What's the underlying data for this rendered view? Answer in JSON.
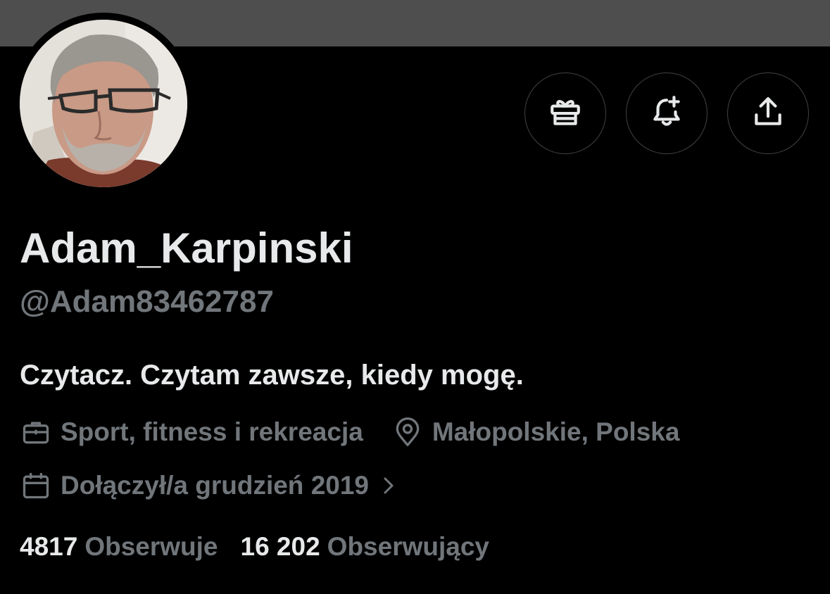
{
  "profile": {
    "display_name": "Adam_Karpinski",
    "handle": "@Adam83462787",
    "bio": "Czytacz. Czytam zawsze, kiedy mogę.",
    "category": "Sport, fitness i rekreacja",
    "location": "Małopolskie, Polska",
    "joined": "Dołączył/a grudzień 2019"
  },
  "stats": {
    "following_count": "4817",
    "following_label": "Obserwuje",
    "followers_count": "16 202",
    "followers_label": "Obserwujący"
  },
  "icons": {
    "gift": "gift-icon",
    "notify": "bell-plus-icon",
    "share": "share-icon",
    "category": "briefcase-icon",
    "location": "location-pin-icon",
    "joined": "calendar-icon",
    "chevron": "chevron-right-icon"
  },
  "colors": {
    "background": "#000000",
    "banner": "#4e4e4e",
    "primary_text": "#e7e9ea",
    "secondary_text": "#71767b",
    "button_border": "#3f4346"
  }
}
